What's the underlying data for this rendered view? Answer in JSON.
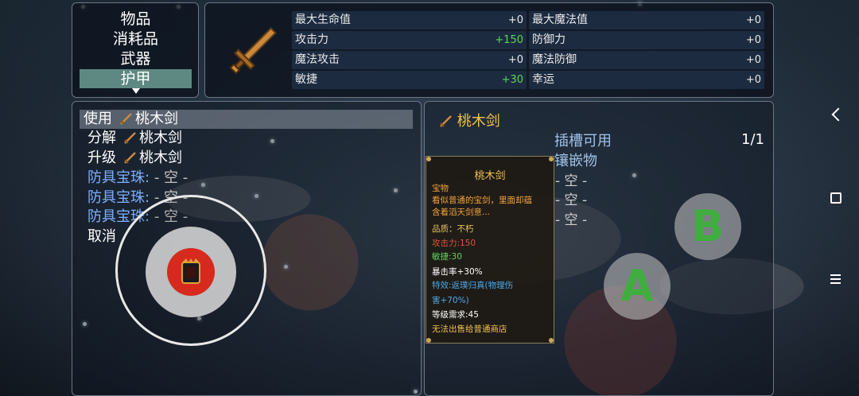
{
  "categories": {
    "items": [
      "物品",
      "消耗品",
      "武器",
      "护甲"
    ],
    "selected_index": 3
  },
  "stats": {
    "left": [
      {
        "label": "最大生命值",
        "value": "+0"
      },
      {
        "label": "攻击力",
        "value": "+150"
      },
      {
        "label": "魔法攻击",
        "value": "+0"
      },
      {
        "label": "敏捷",
        "value": "+30"
      }
    ],
    "right": [
      {
        "label": "最大魔法值",
        "value": "+0"
      },
      {
        "label": "防御力",
        "value": "+0"
      },
      {
        "label": "魔法防御",
        "value": "+0"
      },
      {
        "label": "幸运",
        "value": "+0"
      }
    ]
  },
  "actions": {
    "use_label": "使用",
    "decompose_label": "分解",
    "upgrade_label": "升级",
    "item_name": "桃木剑",
    "gem_label": "防具宝珠:",
    "empty_label": "- 空 -",
    "cancel_label": "取消"
  },
  "detail": {
    "item_name": "桃木剑",
    "slot_available_label": "插槽可用",
    "inlay_label": "镶嵌物",
    "slot_count": "1/1",
    "empty_label": "- 空 -"
  },
  "tooltip": {
    "title": "桃木剑",
    "lines": [
      {
        "text": "宝物",
        "color": "#f2a23a"
      },
      {
        "text": "看似普通的宝剑，里面却蕴",
        "color": "#f2a23a"
      },
      {
        "text": "含着滔天剑意...",
        "color": "#f2a23a"
      },
      {
        "text": "品质：不朽",
        "color": "#e6c05a"
      },
      {
        "text": "攻击力:150",
        "color": "#e0503a"
      },
      {
        "text": "敏捷:30",
        "color": "#5cd65c"
      },
      {
        "text": "暴击率+30%",
        "color": "#ffffff"
      },
      {
        "text": "特效:返璞归真(物理伤",
        "color": "#4fa8e8"
      },
      {
        "text": "害+70%)",
        "color": "#4fa8e8"
      },
      {
        "text": "等级需求:45",
        "color": "#ffffff"
      },
      {
        "text": "无法出售给普通商店",
        "color": "#f2c14e"
      }
    ]
  },
  "controls": {
    "button_a": "A",
    "button_b": "B"
  }
}
